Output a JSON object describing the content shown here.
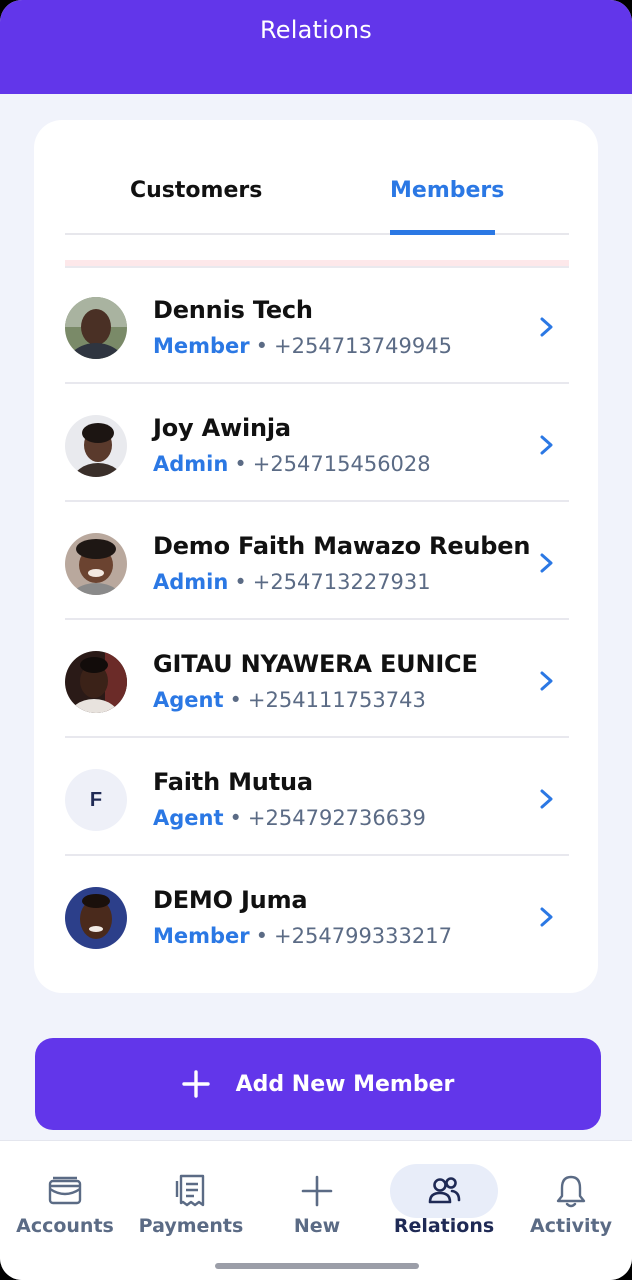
{
  "header": {
    "title": "Relations"
  },
  "tabs": [
    {
      "label": "Customers",
      "active": false
    },
    {
      "label": "Members",
      "active": true
    }
  ],
  "members": [
    {
      "name": "Dennis Tech",
      "role": "Member",
      "phone": "+254713749945",
      "avatar": "photo"
    },
    {
      "name": "Joy Awinja",
      "role": "Admin",
      "phone": "+254715456028",
      "avatar": "photo"
    },
    {
      "name": "Demo Faith Mawazo Reuben",
      "role": "Admin",
      "phone": "+254713227931",
      "avatar": "photo"
    },
    {
      "name": "GITAU NYAWERA EUNICE",
      "role": "Agent",
      "phone": "+254111753743",
      "avatar": "photo"
    },
    {
      "name": "Faith Mutua",
      "role": "Agent",
      "phone": "+254792736639",
      "avatar": "initial",
      "initial": "F"
    },
    {
      "name": "DEMO Juma",
      "role": "Member",
      "phone": "+254799333217",
      "avatar": "photo"
    }
  ],
  "separator": "•",
  "add_button": {
    "label": "Add New Member",
    "icon": "plus-icon"
  },
  "nav": {
    "items": [
      {
        "label": "Accounts",
        "icon": "wallet-icon",
        "active": false
      },
      {
        "label": "Payments",
        "icon": "receipt-icon",
        "active": false
      },
      {
        "label": "New",
        "icon": "plus-icon",
        "active": false
      },
      {
        "label": "Relations",
        "icon": "users-icon",
        "active": true
      },
      {
        "label": "Activity",
        "icon": "bell-icon",
        "active": false
      }
    ]
  },
  "colors": {
    "brand": "#6236ea",
    "accent_blue": "#2b78e4",
    "text_dark": "#111111",
    "text_muted": "#5b6b85",
    "background": "#f1f3fb"
  }
}
